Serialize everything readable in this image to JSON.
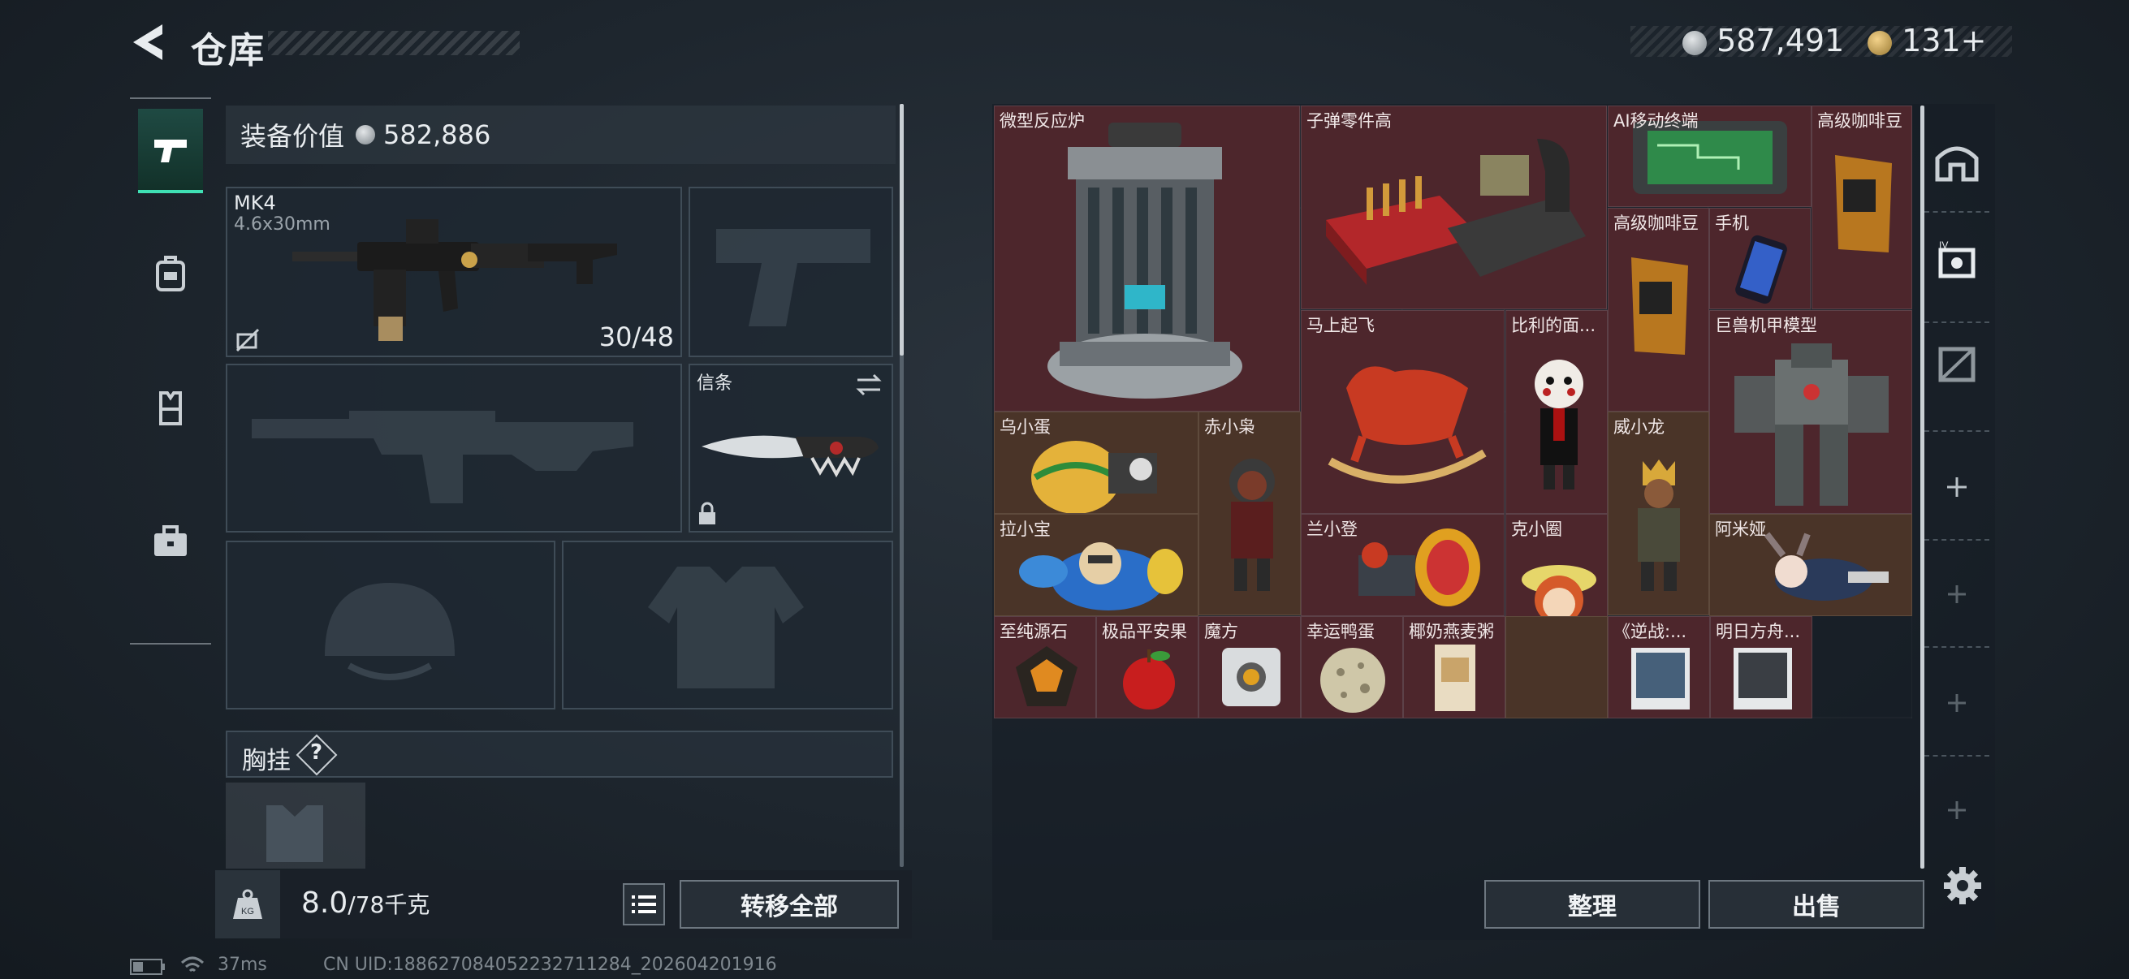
{
  "header": {
    "title": "仓库",
    "currency_a": "587,491",
    "currency_b": "131",
    "plus": "+"
  },
  "equipment": {
    "value_label": "装备价值",
    "value": "582,886",
    "weapon": {
      "name": "MK4",
      "caliber": "4.6x30mm",
      "ammo": "30/48"
    },
    "melee": {
      "name": "信条"
    },
    "chest_rig": {
      "label": "胸挂",
      "help": "?"
    }
  },
  "weight": {
    "current": "8.0",
    "max": "/78千克",
    "badge": "KG"
  },
  "buttons": {
    "transfer_all": "转移全部",
    "sort": "整理",
    "sell": "出售"
  },
  "stash_items": [
    {
      "name": "微型反应炉"
    },
    {
      "name": "子弹零件高"
    },
    {
      "name": "AI移动终端"
    },
    {
      "name": "高级咖啡豆"
    },
    {
      "name": "高级咖啡豆"
    },
    {
      "name": "手机"
    },
    {
      "name": "马上起飞"
    },
    {
      "name": "比利的面..."
    },
    {
      "name": "巨兽机甲模型"
    },
    {
      "name": "乌小蛋"
    },
    {
      "name": "赤小枭"
    },
    {
      "name": "威小龙"
    },
    {
      "name": "拉小宝"
    },
    {
      "name": "兰小登"
    },
    {
      "name": "克小圈"
    },
    {
      "name": "阿米娅"
    },
    {
      "name": "至纯源石"
    },
    {
      "name": "极品平安果"
    },
    {
      "name": "魔方"
    },
    {
      "name": "幸运鸭蛋"
    },
    {
      "name": "椰奶燕麦粥"
    },
    {
      "name": "《逆战:..."
    },
    {
      "name": "明日方舟..."
    }
  ],
  "status": {
    "latency": "37ms",
    "uid": "CN UID:188627084052232711284_202604201916"
  },
  "colors": {
    "accent": "#3fe0b4",
    "gold_cell": "#4a3428",
    "red_cell": "#4d262c"
  }
}
